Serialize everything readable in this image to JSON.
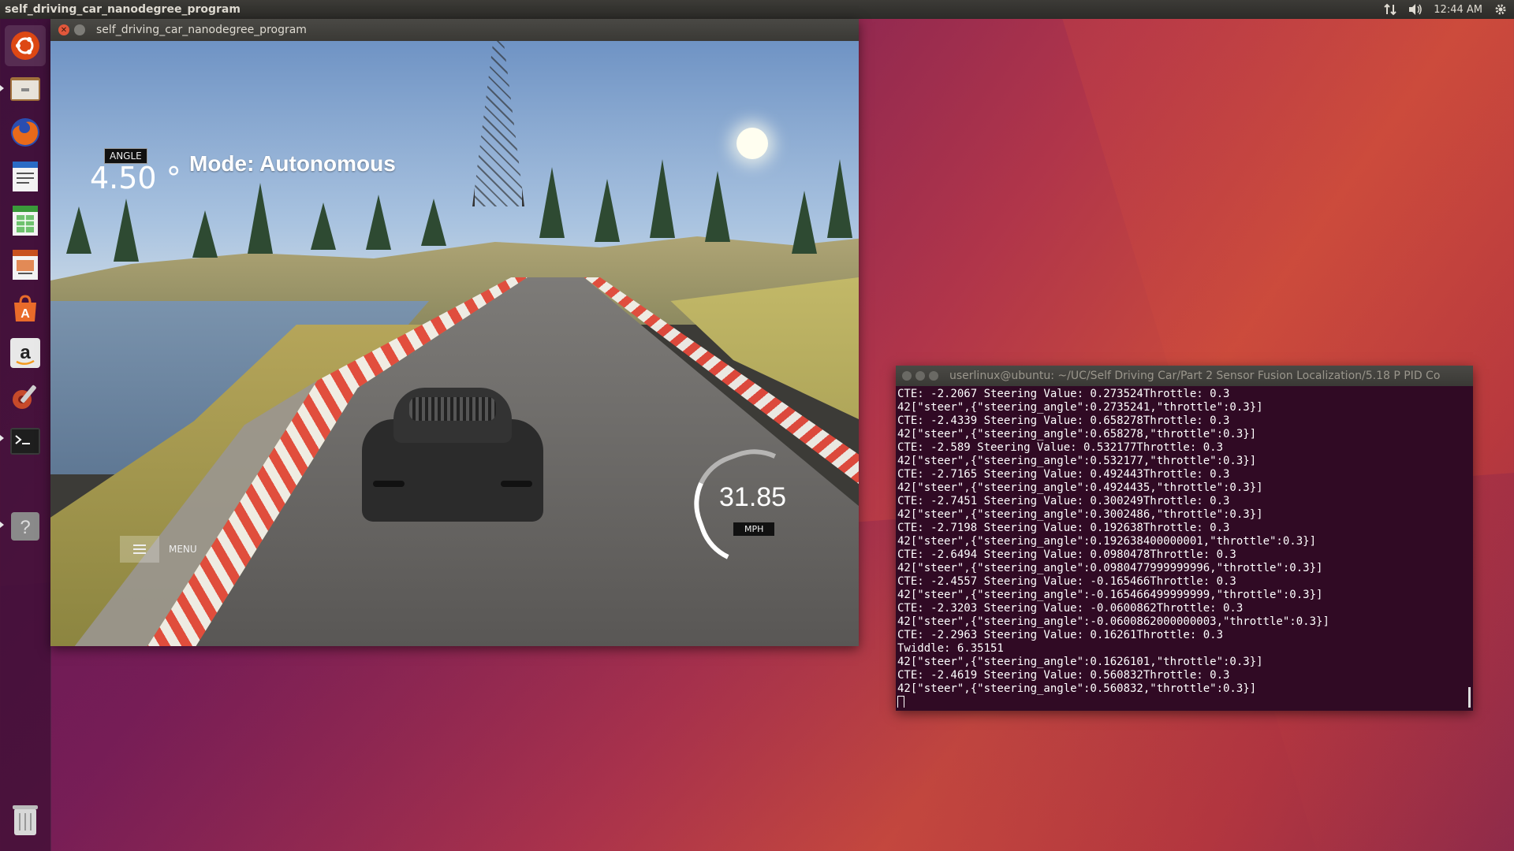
{
  "top_panel": {
    "app_title": "self_driving_car_nanodegree_program",
    "clock": "12:44 AM"
  },
  "launcher": {
    "items": [
      {
        "name": "ubuntu-dash-icon",
        "pip": false
      },
      {
        "name": "files-icon",
        "pip": true
      },
      {
        "name": "firefox-icon",
        "pip": false
      },
      {
        "name": "writer-icon",
        "pip": false
      },
      {
        "name": "calc-icon",
        "pip": false
      },
      {
        "name": "impress-icon",
        "pip": false
      },
      {
        "name": "software-center-icon",
        "pip": false
      },
      {
        "name": "amazon-icon",
        "pip": false
      },
      {
        "name": "system-settings-icon",
        "pip": false
      },
      {
        "name": "terminal-icon",
        "pip": true
      },
      {
        "name": "help-icon",
        "pip": true
      },
      {
        "name": "trash-icon",
        "pip": false
      }
    ]
  },
  "simulator": {
    "window_title": "self_driving_car_nanodegree_program",
    "angle_label": "ANGLE",
    "angle_value": "4.50 °",
    "mode": "Mode: Autonomous",
    "speed": "31.85",
    "speed_unit": "MPH",
    "menu_label": "MENU"
  },
  "terminal": {
    "title": "userlinux@ubuntu: ~/UC/Self Driving Car/Part 2 Sensor Fusion Localization/5.18 P PID Co",
    "lines": [
      "CTE: -2.2067 Steering Value: 0.273524Throttle: 0.3",
      "42[\"steer\",{\"steering_angle\":0.2735241,\"throttle\":0.3}]",
      "CTE: -2.4339 Steering Value: 0.658278Throttle: 0.3",
      "42[\"steer\",{\"steering_angle\":0.658278,\"throttle\":0.3}]",
      "CTE: -2.589 Steering Value: 0.532177Throttle: 0.3",
      "42[\"steer\",{\"steering_angle\":0.532177,\"throttle\":0.3}]",
      "CTE: -2.7165 Steering Value: 0.492443Throttle: 0.3",
      "42[\"steer\",{\"steering_angle\":0.4924435,\"throttle\":0.3}]",
      "CTE: -2.7451 Steering Value: 0.300249Throttle: 0.3",
      "42[\"steer\",{\"steering_angle\":0.3002486,\"throttle\":0.3}]",
      "CTE: -2.7198 Steering Value: 0.192638Throttle: 0.3",
      "42[\"steer\",{\"steering_angle\":0.192638400000001,\"throttle\":0.3}]",
      "CTE: -2.6494 Steering Value: 0.0980478Throttle: 0.3",
      "42[\"steer\",{\"steering_angle\":0.0980477999999996,\"throttle\":0.3}]",
      "CTE: -2.4557 Steering Value: -0.165466Throttle: 0.3",
      "42[\"steer\",{\"steering_angle\":-0.165466499999999,\"throttle\":0.3}]",
      "CTE: -2.3203 Steering Value: -0.0600862Throttle: 0.3",
      "42[\"steer\",{\"steering_angle\":-0.0600862000000003,\"throttle\":0.3}]",
      "CTE: -2.2963 Steering Value: 0.16261Throttle: 0.3",
      "Twiddle: 6.35151",
      "42[\"steer\",{\"steering_angle\":0.1626101,\"throttle\":0.3}]",
      "CTE: -2.4619 Steering Value: 0.560832Throttle: 0.3",
      "42[\"steer\",{\"steering_angle\":0.560832,\"throttle\":0.3}]"
    ]
  }
}
